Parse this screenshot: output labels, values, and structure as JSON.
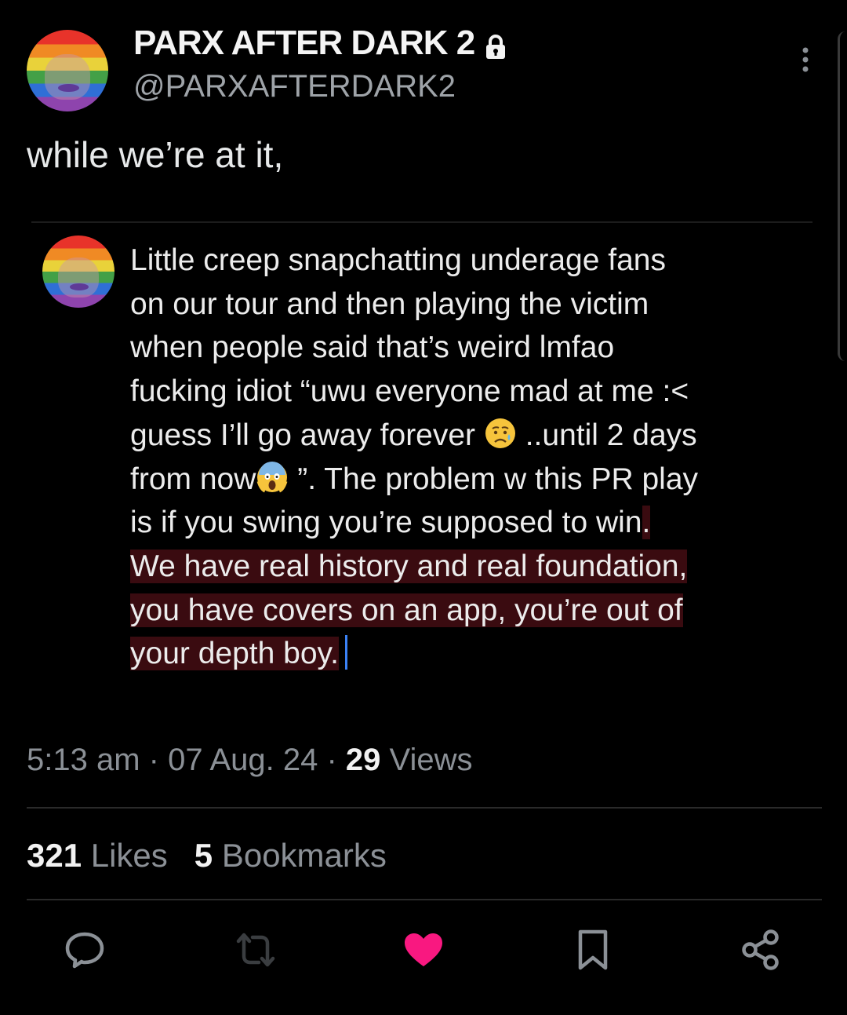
{
  "author": {
    "display_name": "PARX AFTER DARK 2",
    "handle": "@PARXAFTERDARK2"
  },
  "tweet": {
    "text": "while we’re at it,"
  },
  "quote": {
    "lines": [
      "Little creep snapchatting underage fans",
      "on our tour and then playing the victim",
      "when people said that’s weird lmfao",
      "fucking idiot “uwu everyone mad at me :<"
    ],
    "line5_a": "guess I’ll go away forever ",
    "line5_b": " ..until 2 days",
    "line6_a": "from now",
    "line6_b": " ”. The problem w this PR play",
    "line7_a": "is if you swing you’re supposed to win",
    "line7_b": ".",
    "line8": "We have real history and real foundation,",
    "line9": "you have covers on an app, you’re out of",
    "line10": "your depth boy."
  },
  "meta": {
    "time": "5:13 am",
    "sep1": " · ",
    "date": "07 Aug. 24",
    "sep2": " · ",
    "views_count": "29",
    "views_label": " Views"
  },
  "stats": {
    "likes_count": "321",
    "likes_label": " Likes",
    "bookmarks_count": "5",
    "bookmarks_label": " Bookmarks"
  },
  "icons": {
    "lock": "lock-icon",
    "more": "more-vertical-icon",
    "emoji_1": "sad-relieved-face-emoji",
    "emoji_2": "screaming-face-emoji",
    "reply": "reply-icon",
    "retweet": "retweet-icon",
    "like": "heart-icon",
    "bookmark": "bookmark-icon",
    "share": "share-icon"
  },
  "colors": {
    "background": "#000000",
    "text": "#e7e9ea",
    "muted": "#8b9096",
    "like_active": "#f91880",
    "highlight": "#3a0b10",
    "caret": "#3b82f6"
  }
}
